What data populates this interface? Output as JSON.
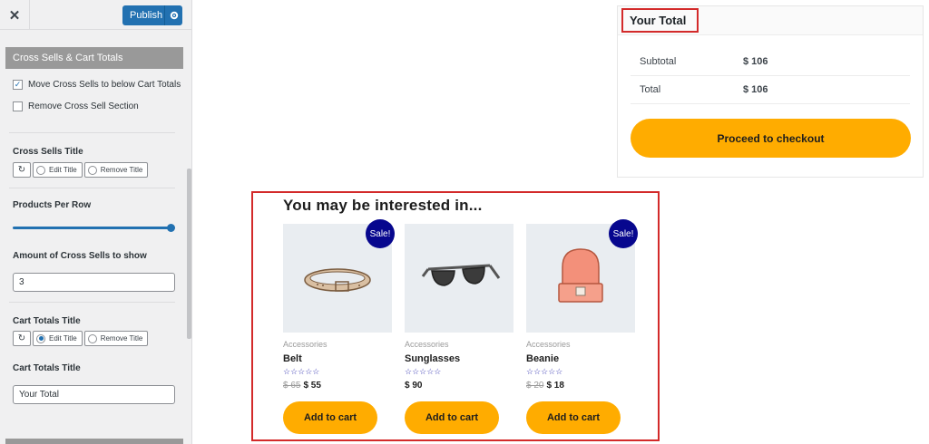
{
  "sidebar": {
    "close_icon": "close-icon",
    "publish_label": "Publish",
    "section_title": "Cross Sells & Cart Totals",
    "move_cross_sells_label": "Move Cross Sells to below Cart Totals",
    "move_cross_sells_checked": true,
    "remove_cross_sell_label": "Remove Cross Sell Section",
    "remove_cross_sell_checked": false,
    "cross_sells_title_label": "Cross Sells Title",
    "cross_sells_edit_title": "Edit Title",
    "cross_sells_remove_title": "Remove Title",
    "products_per_row_label": "Products Per Row",
    "products_per_row_fraction": 1.0,
    "amount_label": "Amount of Cross Sells to show",
    "amount_value": "3",
    "cart_totals_title_label": "Cart Totals Title",
    "cart_totals_edit_title": "Edit Title",
    "cart_totals_remove_title": "Remove Title",
    "cart_totals_title_field_label": "Cart Totals Title",
    "cart_totals_title_value": "Your Total"
  },
  "totals": {
    "title": "Your Total",
    "subtotal_label": "Subtotal",
    "subtotal_value": "$ 106",
    "total_label": "Total",
    "total_value": "$ 106",
    "checkout_label": "Proceed to checkout"
  },
  "cross_sells": {
    "title": "You may be interested in...",
    "products": [
      {
        "category": "Accessories",
        "name": "Belt",
        "stars": "☆☆☆☆☆",
        "old_price": "$ 65",
        "price": "$ 55",
        "sale": "Sale!",
        "button": "Add to cart"
      },
      {
        "category": "Accessories",
        "name": "Sunglasses",
        "stars": "☆☆☆☆☆",
        "old_price": "",
        "price": "$ 90",
        "sale": "",
        "button": "Add to cart"
      },
      {
        "category": "Accessories",
        "name": "Beanie",
        "stars": "☆☆☆☆☆",
        "old_price": "$ 20",
        "price": "$ 18",
        "sale": "Sale!",
        "button": "Add to cart"
      }
    ]
  },
  "colors": {
    "accent_blue": "#2271b1",
    "button_yellow": "#ffac00",
    "sale_badge": "#07078e",
    "highlight_red": "#d32a2a"
  }
}
